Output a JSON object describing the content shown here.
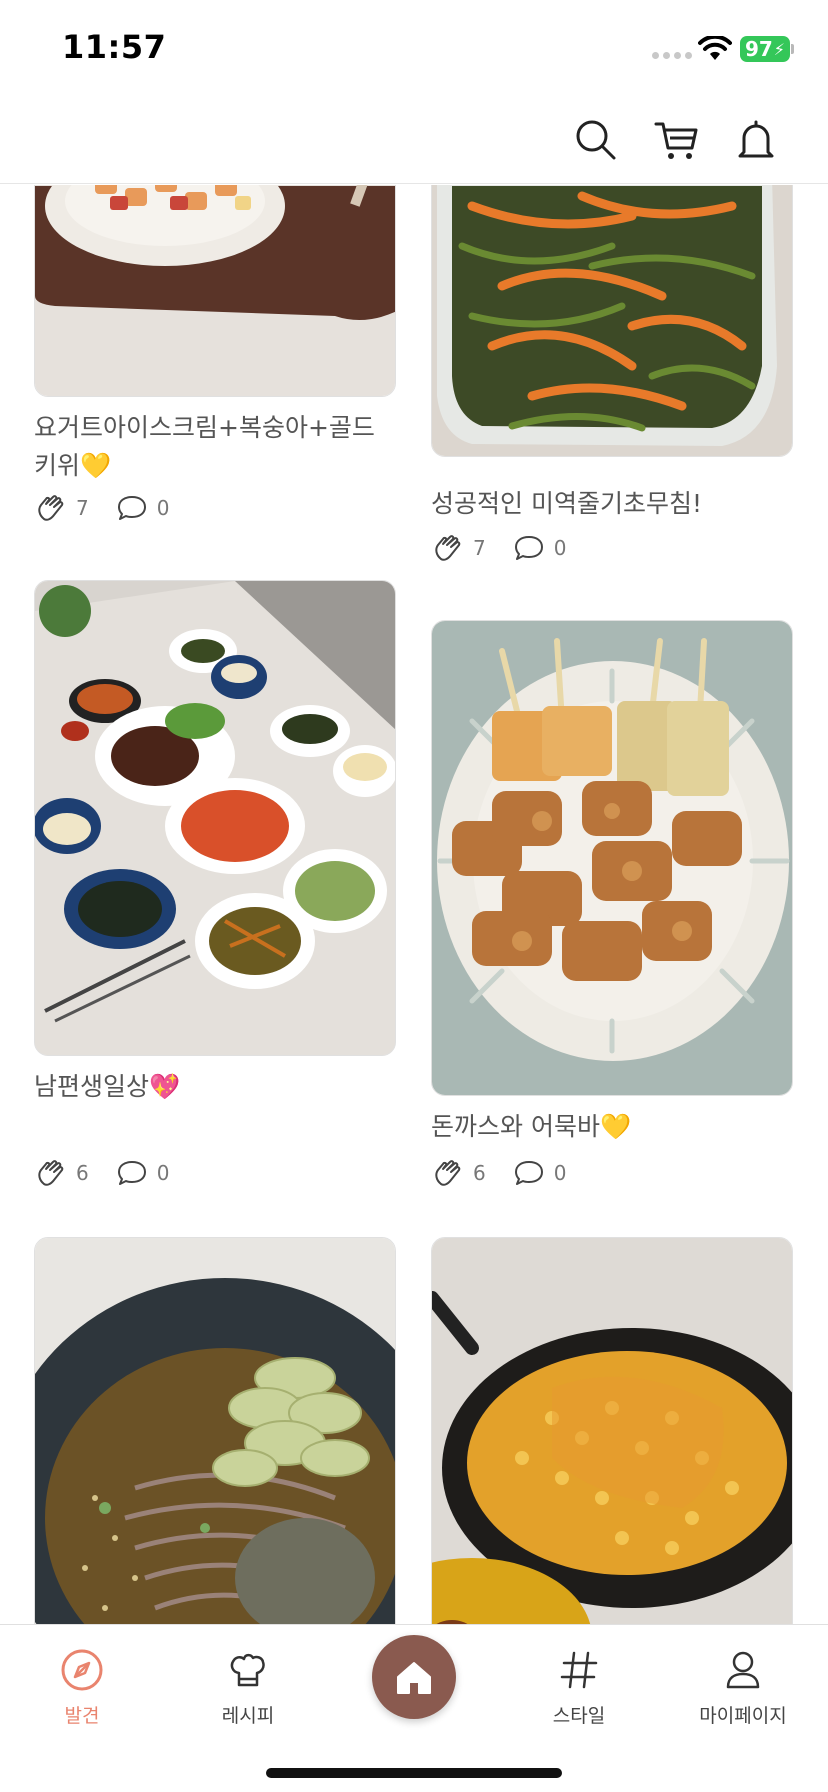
{
  "status": {
    "time": "11:57",
    "battery": "97"
  },
  "header": {
    "icons": [
      "search-icon",
      "cart-icon",
      "bell-icon"
    ]
  },
  "posts": [
    {
      "title": "요거트아이스크림+복숭아+골드키위💛",
      "claps": "7",
      "comments": "0"
    },
    {
      "title": "성공적인 미역줄기초무침!",
      "claps": "7",
      "comments": "0"
    },
    {
      "title": "남편생일상💖",
      "claps": "6",
      "comments": "0"
    },
    {
      "title": "돈까스와 어묵바💛",
      "claps": "6",
      "comments": "0"
    },
    {
      "title": "",
      "claps": "",
      "comments": ""
    },
    {
      "title": "",
      "claps": "",
      "comments": ""
    }
  ],
  "nav": {
    "discover": "발견",
    "recipe": "레시피",
    "style": "스타일",
    "mypage": "마이페이지"
  },
  "colors": {
    "accent": "#e9846e",
    "home": "#8a5a4f",
    "battery": "#34c759"
  }
}
